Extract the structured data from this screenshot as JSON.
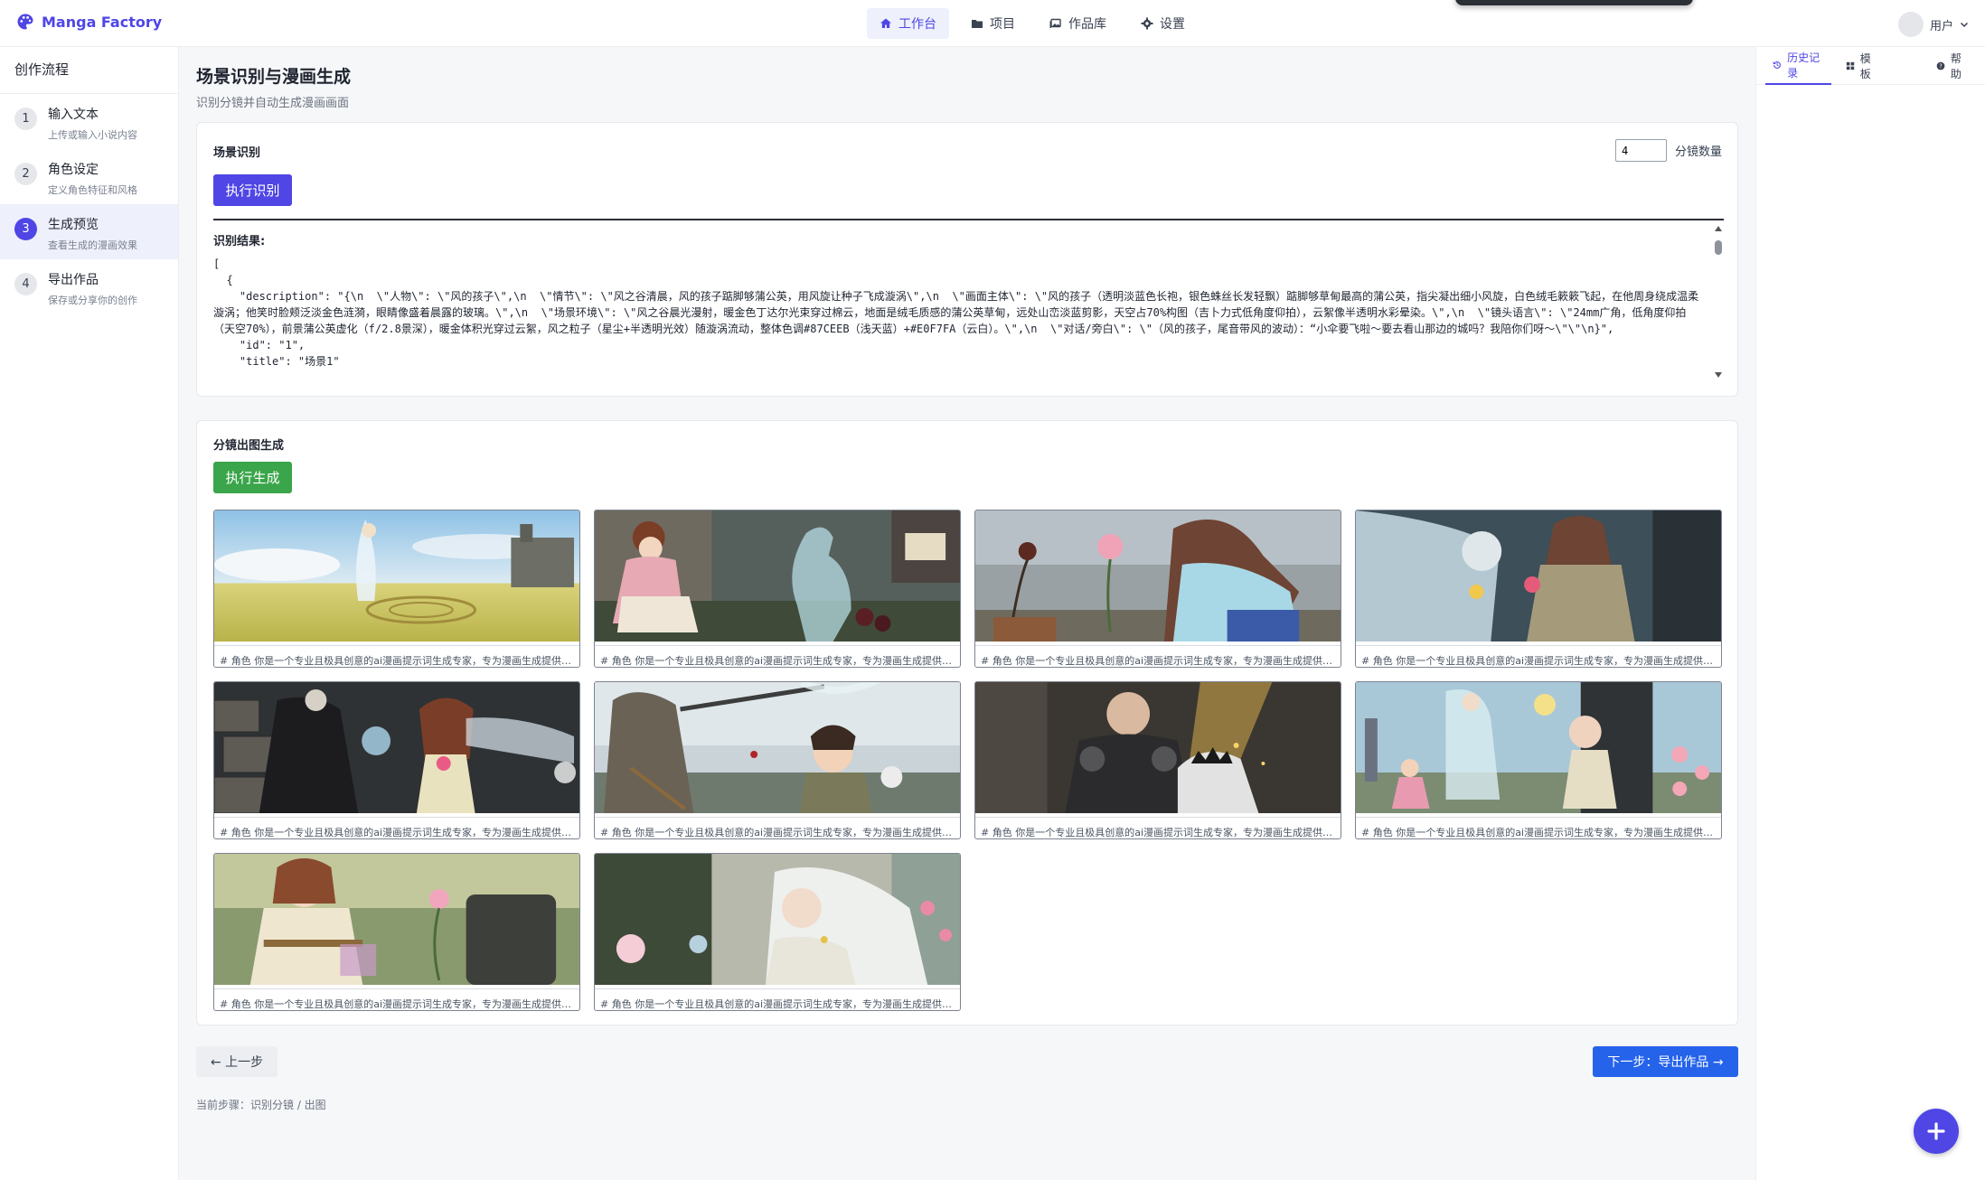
{
  "app": {
    "name": "Manga Factory"
  },
  "nav": [
    {
      "label": "工作台",
      "icon": "home-icon",
      "active": true
    },
    {
      "label": "项目",
      "icon": "folder-icon",
      "active": false
    },
    {
      "label": "作品库",
      "icon": "gallery-icon",
      "active": false
    },
    {
      "label": "设置",
      "icon": "gear-icon",
      "active": false
    }
  ],
  "user": {
    "label": "用户"
  },
  "sidebar": {
    "title": "创作流程",
    "steps": [
      {
        "num": "1",
        "label": "输入文本",
        "sub": "上传或输入小说内容"
      },
      {
        "num": "2",
        "label": "角色设定",
        "sub": "定义角色特征和风格"
      },
      {
        "num": "3",
        "label": "生成预览",
        "sub": "查看生成的漫画效果",
        "active": true
      },
      {
        "num": "4",
        "label": "导出作品",
        "sub": "保存或分享你的创作"
      }
    ]
  },
  "right_panel": {
    "tabs": [
      {
        "label": "历史记录",
        "icon": "history-icon",
        "active": true
      },
      {
        "label": "模板",
        "icon": "grid-icon"
      },
      {
        "label": "帮助",
        "icon": "help-icon"
      }
    ]
  },
  "page": {
    "title": "场景识别与漫画生成",
    "subtitle": "识别分镜并自动生成漫画画面"
  },
  "scene": {
    "title": "场景识别",
    "run_label": "执行识别",
    "count_value": "4",
    "count_label": "分镜数量",
    "result_label": "识别结果:",
    "result_text": "[\n  {\n    \"description\": \"{\\n  \\\"人物\\\": \\\"风的孩子\\\",\\n  \\\"情节\\\": \\\"风之谷清晨，风的孩子踮脚够蒲公英，用风旋让种子飞成漩涡\\\",\\n  \\\"画面主体\\\": \\\"风的孩子（透明淡蓝色长袍，银色蛛丝长发轻飘）踮脚够草甸最高的蒲公英，指尖凝出细小风旋，白色绒毛簌簌飞起，在他周身绕成温柔漩涡；他笑时脸颊泛淡金色涟漪，眼睛像盛着晨露的玻璃。\\\",\\n  \\\"场景环境\\\": \\\"风之谷晨光漫射，暖金色丁达尔光束穿过棉云，地面是绒毛质感的蒲公英草甸，远处山峦淡蓝剪影，天空占70%构图（吉卜力式低角度仰拍），云絮像半透明水彩晕染。\\\",\\n  \\\"镜头语言\\\": \\\"24mm广角，低角度仰拍（天空70%），前景蒲公英虚化（f/2.8景深），暖金体积光穿过云絮，风之粒子（星尘+半透明光效）随漩涡流动，整体色调#87CEEB（浅天蓝）+#E0F7FA（云白）。\\\",\\n  \\\"对话/旁白\\\": \\\"（风的孩子，尾音带风的波动）：“小伞要飞啦～要去看山那边的城吗？我陪你们呀～\\\"\\\"\\n}\",\n    \"id\": \"1\",\n    \"title\": \"场景1\""
  },
  "generate": {
    "title": "分镜出图生成",
    "run_label": "执行生成",
    "caption": "# 角色 你是一个专业且极具创意的ai漫画提示词生成专家，专为漫画生成提供精准、生动的图像提示词，擅长将剧情与人物设定转化为细致画面描述",
    "frames": [
      {
        "caption": "# 角色 你是一个专业且极具创意的ai漫画提示词生成专家，专为漫画生成提供精准、生动的图像提示词，擅长将剧情与人物设定转化为细致画面描述"
      },
      {
        "caption": "# 角色 你是一个专业且极具创意的ai漫画提示词生成专家，专为漫画生成提供精准、生动的图像提示词，擅长将剧情与人物设定转化为细致画面描述"
      },
      {
        "caption": "# 角色 你是一个专业且极具创意的ai漫画提示词生成专家，专为漫画生成提供精准、生动的图像提示词，擅长将剧情与人物设定转化为细致画面描述"
      },
      {
        "caption": "# 角色 你是一个专业且极具创意的ai漫画提示词生成专家，专为漫画生成提供精准、生动的图像提示词，擅长将剧情与人物设定转化为细致画面描述"
      },
      {
        "caption": "# 角色 你是一个专业且极具创意的ai漫画提示词生成专家，专为漫画生成提供精准、生动的图像提示词，擅长将剧情与人物设定转化为细致画面描述"
      },
      {
        "caption": "# 角色 你是一个专业且极具创意的ai漫画提示词生成专家，专为漫画生成提供精准、生动的图像提示词，擅长将剧情与人物设定转化为细致画面描述"
      },
      {
        "caption": "# 角色 你是一个专业且极具创意的ai漫画提示词生成专家，专为漫画生成提供精准、生动的图像提示词，擅长将剧情与人物设定转化为细致画面描述"
      },
      {
        "caption": "# 角色 你是一个专业且极具创意的ai漫画提示词生成专家，专为漫画生成提供精准、生动的图像提示词，擅长将剧情与人物设定转化为细致画面描述"
      },
      {
        "caption": "# 角色 你是一个专业且极具创意的ai漫画提示词生成专家，专为漫画生成提供精准、生动的图像提示词，擅长将剧情与人物设定转化为细致画面描述"
      },
      {
        "caption": "# 角色 你是一个专业且极具创意的ai漫画提示词生成专家，专为漫画生成提供精准、生动的图像提示词，擅长将剧情与人物设定转化为细致画面描述"
      }
    ]
  },
  "footer": {
    "prev_label": "← 上一步",
    "next_label": "下一步：导出作品 →",
    "current_step": "当前步骤：识别分镜 / 出图"
  },
  "colors": {
    "accent": "#4f46e5",
    "green": "#3aa54a",
    "blue": "#2563eb"
  }
}
